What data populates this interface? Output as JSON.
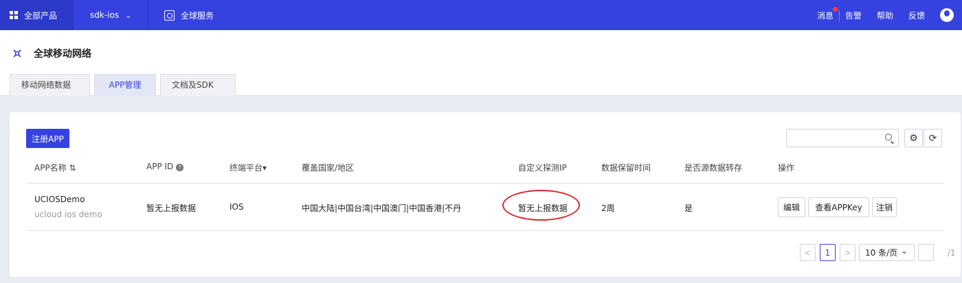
{
  "topbar": {
    "all_products": "全部产品",
    "project": "sdk-ios",
    "service": "全球服务",
    "messages": "消息",
    "alerts": "告警",
    "help": "帮助",
    "feedback": "反馈",
    "colors": {
      "bar": "#3542e0",
      "badge": "#ff3b30"
    }
  },
  "page": {
    "title": "全球移动网络",
    "tabs": [
      {
        "label": "移动网络数据",
        "active": false
      },
      {
        "label": "APP管理",
        "active": true
      },
      {
        "label": "文档及SDK",
        "active": false
      }
    ]
  },
  "toolbar": {
    "register_label": "注册APP",
    "search_placeholder": ""
  },
  "table": {
    "headers": [
      "APP名称",
      "APP ID",
      "终端平台",
      "覆盖国家/地区",
      "自定义探测IP",
      "数据保留时间",
      "是否源数据转存",
      "操作"
    ],
    "rows": [
      {
        "name": "UCIOSDemo",
        "desc": "ucloud ios demo",
        "app_id": "暂无上报数据",
        "platform": "IOS",
        "regions": "中国大陆|中国台湾|中国澳门|中国香港|不丹",
        "probe_ip": "暂无上报数据",
        "retention": "2周",
        "dump": "是",
        "actions": [
          "编辑",
          "查看APPKey",
          "注销"
        ]
      }
    ]
  },
  "pagination": {
    "prev": "<",
    "current": "1",
    "next": ">",
    "page_size": "10 条/页",
    "jump_value": "",
    "total": "/1"
  }
}
